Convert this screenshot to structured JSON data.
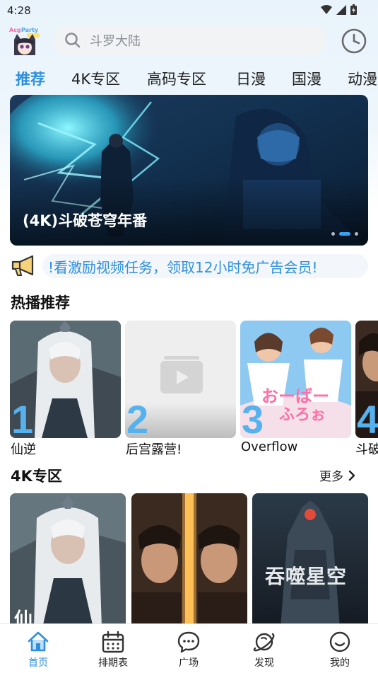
{
  "status": {
    "time": "4:28"
  },
  "logo": {
    "text": "AcgParty"
  },
  "search": {
    "placeholder": "斗罗大陆"
  },
  "tabs": [
    {
      "label": "推荐",
      "active": true
    },
    {
      "label": "4K专区"
    },
    {
      "label": "高码专区"
    },
    {
      "label": "日漫"
    },
    {
      "label": "国漫"
    },
    {
      "label": "动漫"
    }
  ],
  "banner": {
    "title": "(4K)斗破苍穹年番",
    "slide_count": 3,
    "active_slide": 2
  },
  "notice": {
    "text": "!看激励视频任务，领取12小时免广告会员!"
  },
  "hot": {
    "title": "热播推荐",
    "items": [
      {
        "rank": "1",
        "name": "仙逆"
      },
      {
        "rank": "2",
        "name": "后宫露营!"
      },
      {
        "rank": "3",
        "name": "Overflow"
      },
      {
        "rank": "4",
        "name": "斗破"
      }
    ]
  },
  "k4": {
    "title": "4K专区",
    "more": "更多",
    "cards": [
      {
        "caption": "仙"
      },
      {
        "caption": ""
      },
      {
        "caption": "吞噬星空"
      }
    ]
  },
  "nav": [
    {
      "label": "首页",
      "icon": "home-icon",
      "active": true
    },
    {
      "label": "排期表",
      "icon": "calendar-icon"
    },
    {
      "label": "广场",
      "icon": "chat-icon"
    },
    {
      "label": "发现",
      "icon": "planet-icon"
    },
    {
      "label": "我的",
      "icon": "smile-icon"
    }
  ],
  "colors": {
    "accent": "#2f8fdd",
    "rank": "#56b2ef"
  }
}
